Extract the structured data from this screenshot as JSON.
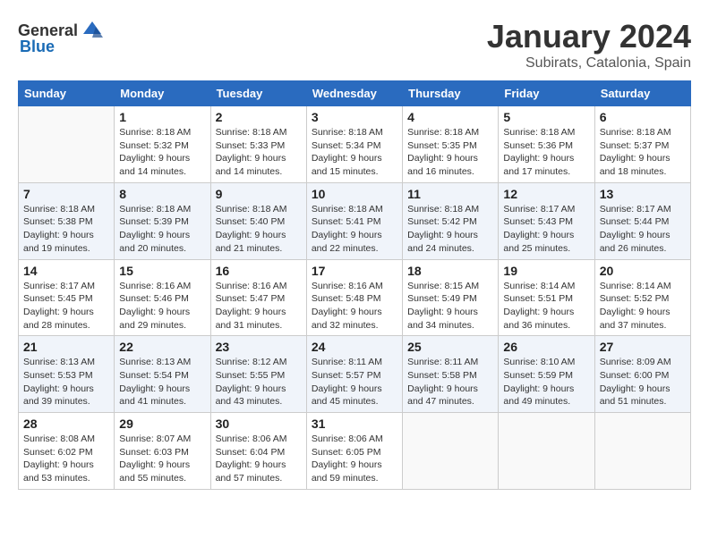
{
  "header": {
    "logo_general": "General",
    "logo_blue": "Blue",
    "month_year": "January 2024",
    "location": "Subirats, Catalonia, Spain"
  },
  "columns": [
    "Sunday",
    "Monday",
    "Tuesday",
    "Wednesday",
    "Thursday",
    "Friday",
    "Saturday"
  ],
  "weeks": [
    {
      "row_class": "row-white",
      "days": [
        {
          "num": "",
          "info": ""
        },
        {
          "num": "1",
          "info": "Sunrise: 8:18 AM\nSunset: 5:32 PM\nDaylight: 9 hours\nand 14 minutes."
        },
        {
          "num": "2",
          "info": "Sunrise: 8:18 AM\nSunset: 5:33 PM\nDaylight: 9 hours\nand 14 minutes."
        },
        {
          "num": "3",
          "info": "Sunrise: 8:18 AM\nSunset: 5:34 PM\nDaylight: 9 hours\nand 15 minutes."
        },
        {
          "num": "4",
          "info": "Sunrise: 8:18 AM\nSunset: 5:35 PM\nDaylight: 9 hours\nand 16 minutes."
        },
        {
          "num": "5",
          "info": "Sunrise: 8:18 AM\nSunset: 5:36 PM\nDaylight: 9 hours\nand 17 minutes."
        },
        {
          "num": "6",
          "info": "Sunrise: 8:18 AM\nSunset: 5:37 PM\nDaylight: 9 hours\nand 18 minutes."
        }
      ]
    },
    {
      "row_class": "row-alt",
      "days": [
        {
          "num": "7",
          "info": "Sunrise: 8:18 AM\nSunset: 5:38 PM\nDaylight: 9 hours\nand 19 minutes."
        },
        {
          "num": "8",
          "info": "Sunrise: 8:18 AM\nSunset: 5:39 PM\nDaylight: 9 hours\nand 20 minutes."
        },
        {
          "num": "9",
          "info": "Sunrise: 8:18 AM\nSunset: 5:40 PM\nDaylight: 9 hours\nand 21 minutes."
        },
        {
          "num": "10",
          "info": "Sunrise: 8:18 AM\nSunset: 5:41 PM\nDaylight: 9 hours\nand 22 minutes."
        },
        {
          "num": "11",
          "info": "Sunrise: 8:18 AM\nSunset: 5:42 PM\nDaylight: 9 hours\nand 24 minutes."
        },
        {
          "num": "12",
          "info": "Sunrise: 8:17 AM\nSunset: 5:43 PM\nDaylight: 9 hours\nand 25 minutes."
        },
        {
          "num": "13",
          "info": "Sunrise: 8:17 AM\nSunset: 5:44 PM\nDaylight: 9 hours\nand 26 minutes."
        }
      ]
    },
    {
      "row_class": "row-white",
      "days": [
        {
          "num": "14",
          "info": "Sunrise: 8:17 AM\nSunset: 5:45 PM\nDaylight: 9 hours\nand 28 minutes."
        },
        {
          "num": "15",
          "info": "Sunrise: 8:16 AM\nSunset: 5:46 PM\nDaylight: 9 hours\nand 29 minutes."
        },
        {
          "num": "16",
          "info": "Sunrise: 8:16 AM\nSunset: 5:47 PM\nDaylight: 9 hours\nand 31 minutes."
        },
        {
          "num": "17",
          "info": "Sunrise: 8:16 AM\nSunset: 5:48 PM\nDaylight: 9 hours\nand 32 minutes."
        },
        {
          "num": "18",
          "info": "Sunrise: 8:15 AM\nSunset: 5:49 PM\nDaylight: 9 hours\nand 34 minutes."
        },
        {
          "num": "19",
          "info": "Sunrise: 8:14 AM\nSunset: 5:51 PM\nDaylight: 9 hours\nand 36 minutes."
        },
        {
          "num": "20",
          "info": "Sunrise: 8:14 AM\nSunset: 5:52 PM\nDaylight: 9 hours\nand 37 minutes."
        }
      ]
    },
    {
      "row_class": "row-alt",
      "days": [
        {
          "num": "21",
          "info": "Sunrise: 8:13 AM\nSunset: 5:53 PM\nDaylight: 9 hours\nand 39 minutes."
        },
        {
          "num": "22",
          "info": "Sunrise: 8:13 AM\nSunset: 5:54 PM\nDaylight: 9 hours\nand 41 minutes."
        },
        {
          "num": "23",
          "info": "Sunrise: 8:12 AM\nSunset: 5:55 PM\nDaylight: 9 hours\nand 43 minutes."
        },
        {
          "num": "24",
          "info": "Sunrise: 8:11 AM\nSunset: 5:57 PM\nDaylight: 9 hours\nand 45 minutes."
        },
        {
          "num": "25",
          "info": "Sunrise: 8:11 AM\nSunset: 5:58 PM\nDaylight: 9 hours\nand 47 minutes."
        },
        {
          "num": "26",
          "info": "Sunrise: 8:10 AM\nSunset: 5:59 PM\nDaylight: 9 hours\nand 49 minutes."
        },
        {
          "num": "27",
          "info": "Sunrise: 8:09 AM\nSunset: 6:00 PM\nDaylight: 9 hours\nand 51 minutes."
        }
      ]
    },
    {
      "row_class": "row-white",
      "days": [
        {
          "num": "28",
          "info": "Sunrise: 8:08 AM\nSunset: 6:02 PM\nDaylight: 9 hours\nand 53 minutes."
        },
        {
          "num": "29",
          "info": "Sunrise: 8:07 AM\nSunset: 6:03 PM\nDaylight: 9 hours\nand 55 minutes."
        },
        {
          "num": "30",
          "info": "Sunrise: 8:06 AM\nSunset: 6:04 PM\nDaylight: 9 hours\nand 57 minutes."
        },
        {
          "num": "31",
          "info": "Sunrise: 8:06 AM\nSunset: 6:05 PM\nDaylight: 9 hours\nand 59 minutes."
        },
        {
          "num": "",
          "info": ""
        },
        {
          "num": "",
          "info": ""
        },
        {
          "num": "",
          "info": ""
        }
      ]
    }
  ]
}
